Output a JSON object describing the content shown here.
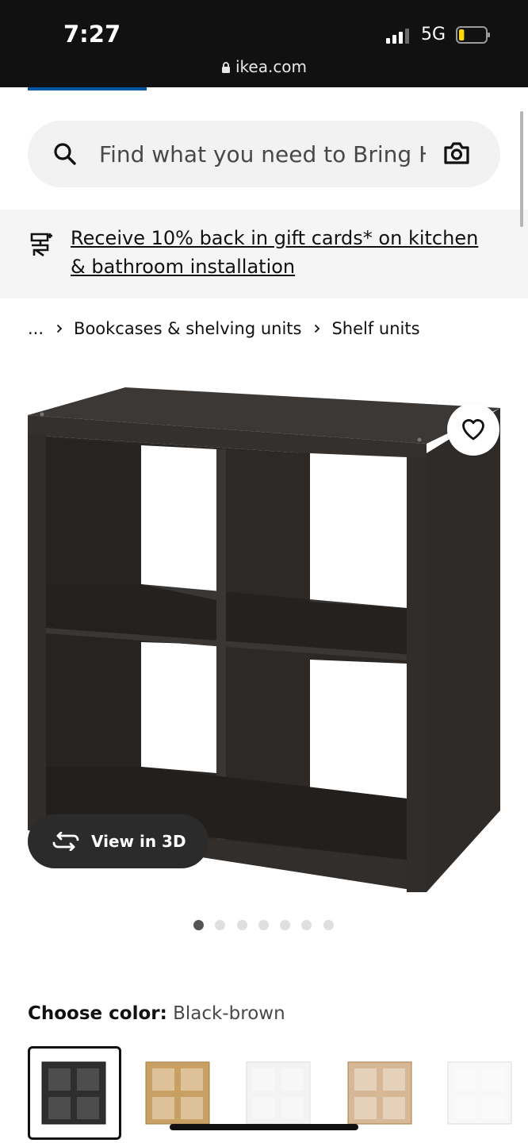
{
  "status_bar": {
    "time": "7:27",
    "network": "5G",
    "url": "ikea.com",
    "battery_level_percent": 20,
    "battery_color": "#ffd600"
  },
  "search": {
    "placeholder": "Find what you need to Bring Home",
    "icon": "search-icon",
    "camera_icon": "camera-icon"
  },
  "promo": {
    "text": "Receive 10% back in gift cards* on kitchen & bathroom installation",
    "icon": "tools-icon"
  },
  "breadcrumb": {
    "ellipsis": "...",
    "items": [
      "Bookcases & shelving units",
      "Shelf units"
    ]
  },
  "product": {
    "favorite_icon": "heart-icon",
    "view_3d_label": "View in 3D",
    "image_count": 7,
    "active_image_index": 0
  },
  "color": {
    "label": "Choose color:",
    "selected_value": "Black-brown",
    "swatches": [
      {
        "name": "black-brown",
        "color": "#2e2e2e",
        "selected": true
      },
      {
        "name": "oak-effect",
        "color": "#c9a063",
        "selected": false
      },
      {
        "name": "white",
        "color": "#f3f3f3",
        "selected": false
      },
      {
        "name": "white-stained-oak",
        "color": "#d7b896",
        "selected": false
      },
      {
        "name": "high-gloss-white",
        "color": "#f8f8f8",
        "selected": false
      }
    ]
  },
  "colors": {
    "accent": "#0058a3",
    "status_bar_bg": "#111111",
    "search_bg": "#f2f2f2",
    "promo_bg": "#f5f5f5"
  }
}
